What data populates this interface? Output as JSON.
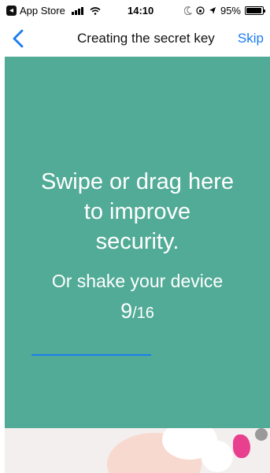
{
  "status_bar": {
    "back_app_label": "App Store",
    "time": "14:10",
    "battery_percent": "95%",
    "battery_level": 0.95,
    "icons": [
      "signal-icon",
      "wifi-icon",
      "moon-icon",
      "lock-rotation-icon",
      "location-icon",
      "battery-icon"
    ]
  },
  "nav": {
    "title": "Creating the secret key",
    "skip_label": "Skip",
    "back_icon": "chevron-left-icon"
  },
  "swipe_area": {
    "instruction_lines": [
      "Swipe or drag here",
      "to improve",
      "security."
    ],
    "shake_text": "Or shake your device",
    "progress_current": "9",
    "progress_total": "/16",
    "progress_fraction": 0.5625
  },
  "colors": {
    "accent": "#1a7cf0",
    "swipe_background": "#52ab97"
  }
}
